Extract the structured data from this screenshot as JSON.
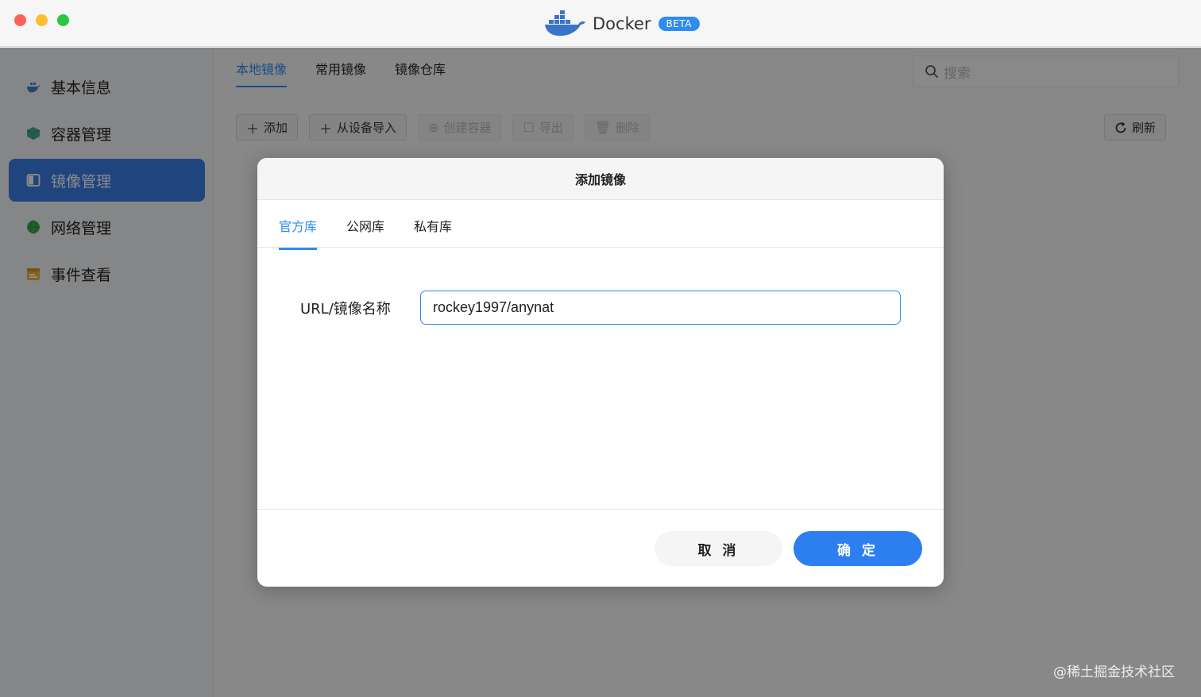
{
  "window": {
    "app_name": "Docker",
    "badge": "BETA"
  },
  "sidebar": {
    "items": [
      {
        "label": "基本信息",
        "icon": "docker-whale-icon",
        "active": false
      },
      {
        "label": "容器管理",
        "icon": "cube-icon",
        "active": false
      },
      {
        "label": "镜像管理",
        "icon": "image-icon",
        "active": true
      },
      {
        "label": "网络管理",
        "icon": "globe-icon",
        "active": false
      },
      {
        "label": "事件查看",
        "icon": "calendar-icon",
        "active": false
      }
    ]
  },
  "main": {
    "tabs": [
      {
        "label": "本地镜像",
        "active": true
      },
      {
        "label": "常用镜像",
        "active": false
      },
      {
        "label": "镜像仓库",
        "active": false
      }
    ],
    "search_placeholder": "搜索",
    "toolbar": {
      "add": "添加",
      "import": "从设备导入",
      "create_container": "创建容器",
      "export": "导出",
      "delete": "删除",
      "refresh": "刷新"
    }
  },
  "modal": {
    "title": "添加镜像",
    "tabs": [
      {
        "label": "官方库",
        "active": true
      },
      {
        "label": "公网库",
        "active": false
      },
      {
        "label": "私有库",
        "active": false
      }
    ],
    "field_label": "URL/镜像名称",
    "field_value": "rockey1997/anynat",
    "cancel": "取 消",
    "confirm": "确 定"
  },
  "watermark": "@稀土掘金技术社区",
  "colors": {
    "accent": "#2d8cf0",
    "sidebar_active": "#3b7ce6"
  }
}
